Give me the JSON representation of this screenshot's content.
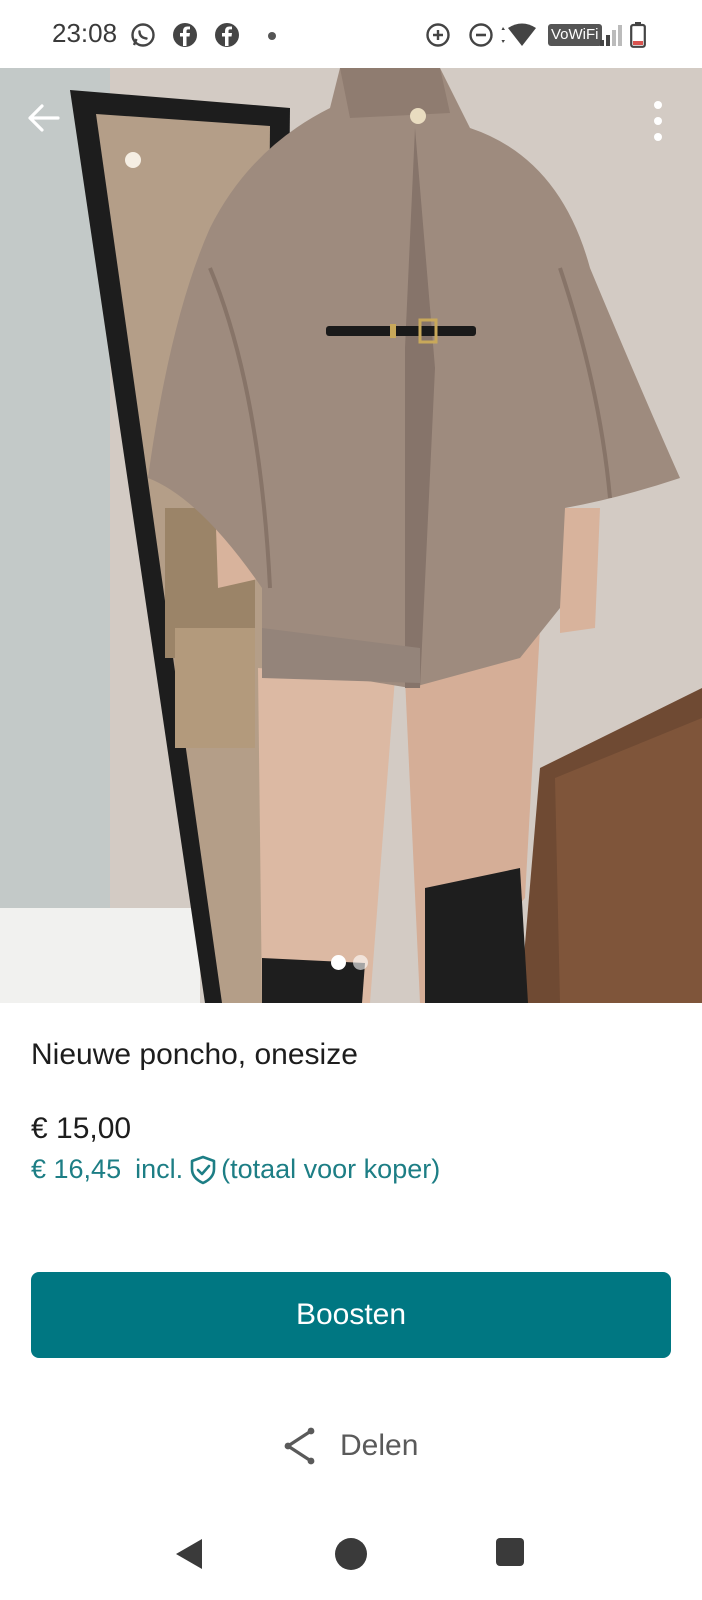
{
  "status_bar": {
    "time": "23:08",
    "icons": [
      "whatsapp-icon",
      "facebook-icon",
      "facebook-icon",
      "dot",
      "data-saver-icon",
      "do-not-disturb-icon",
      "wifi-icon",
      "vowifi-badge",
      "signal-icon",
      "battery-icon"
    ],
    "vowifi_label": "VoWiFi"
  },
  "photo": {
    "page_count": 2,
    "current_page": 1
  },
  "listing": {
    "title": "Nieuwe poncho, onesize",
    "price": "€ 15,00",
    "total_price": "€ 16,45",
    "total_incl": "incl.",
    "total_note": "(totaal voor koper)"
  },
  "actions": {
    "boost_label": "Boosten",
    "share_label": "Delen"
  },
  "colors": {
    "accent": "#007782",
    "accent_text": "#1d7e85"
  }
}
